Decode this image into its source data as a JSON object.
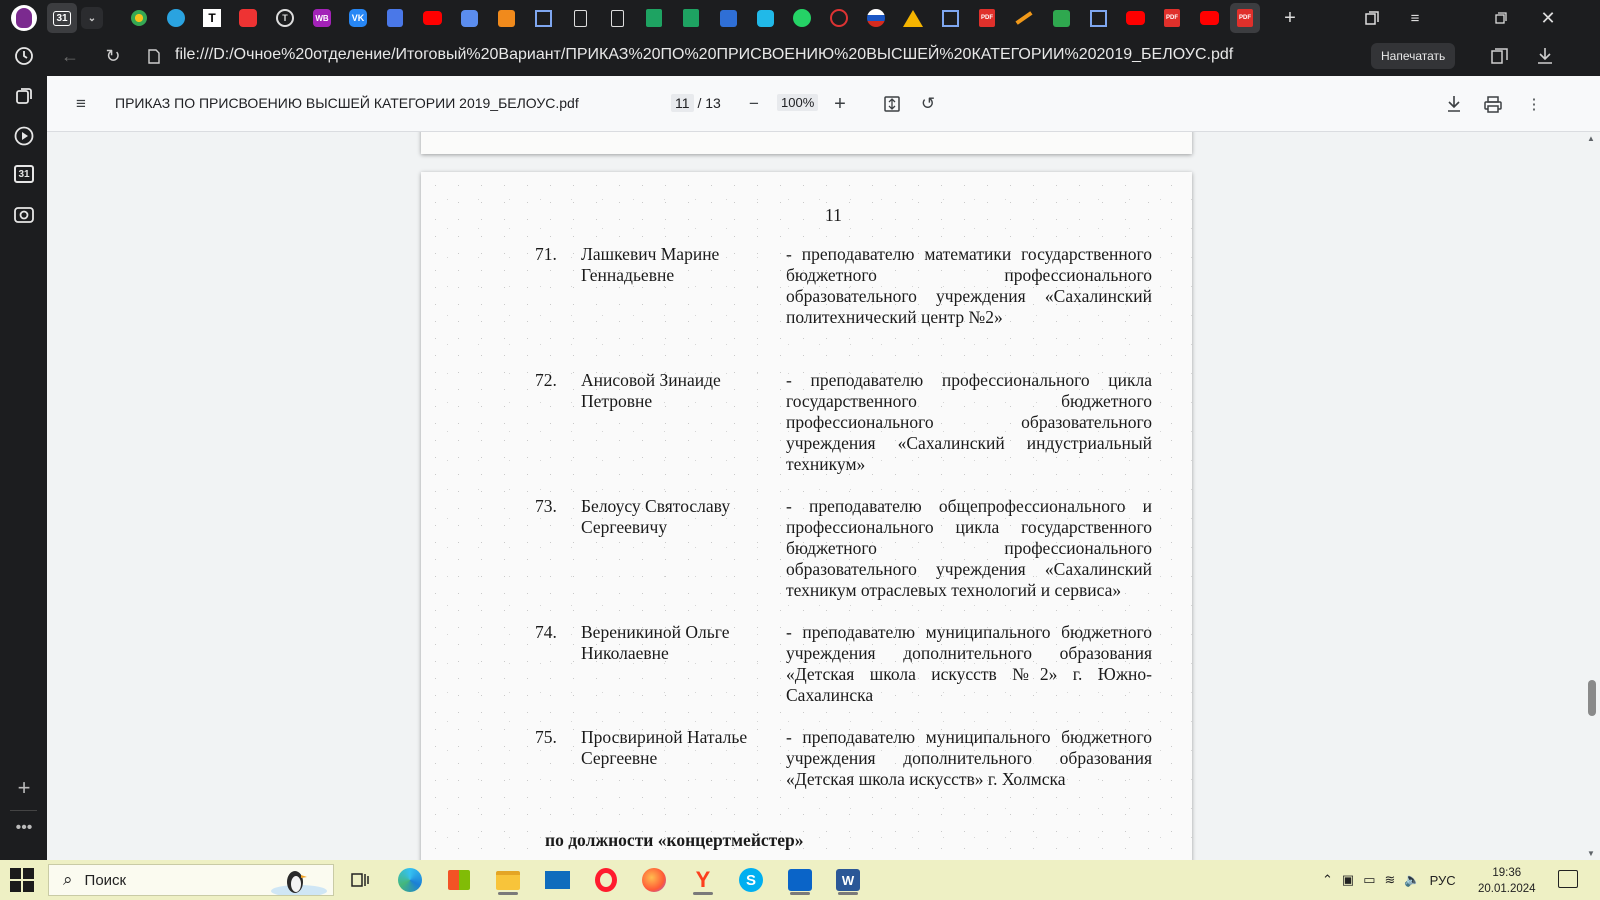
{
  "browser": {
    "url": "file:///D:/Очное%20отделение/Итоговый%20Вариант/ПРИКАЗ%20ПО%20ПРИСВОЕНИЮ%20ВЫСШЕЙ%20КАТЕГОРИИ%202019_БЕЛОУС.pdf",
    "print_button": "Напечатать",
    "active_tab_badge": "31",
    "sidebar_calendar": "31"
  },
  "pdf_toolbar": {
    "title": "ПРИКАЗ ПО ПРИСВОЕНИЮ ВЫСШЕЙ КАТЕГОРИИ 2019_БЕЛОУС.pdf",
    "current_page": "11",
    "page_separator": "/",
    "total_pages": "13",
    "zoom": "100%"
  },
  "document": {
    "page_number": "11",
    "entries": [
      {
        "num": "71.",
        "name": "Лашкевич Марине Геннадьевне",
        "desc": "- преподавателю математики государственного бюджетного профессионального образовательного учреждения «Сахалинский политехнический центр №2»"
      },
      {
        "num": "72.",
        "name": "Анисовой Зинаиде Петровне",
        "desc": "- преподавателю профессионального цикла государственного бюджетного профессионального образовательного учреждения «Сахалинский индустриальный техникум»"
      },
      {
        "num": "73.",
        "name": "Белоусу Святославу Сергеевичу",
        "desc": "- преподавателю общепрофессионального и профессионального цикла государственного бюджетного профессионального образовательного учреждения «Сахалинский техникум отраслевых технологий и сервиса»"
      },
      {
        "num": "74.",
        "name": "Вереникиной Ольге Николаевне",
        "desc": "- преподавателю муниципального бюджетного учреждения дополнительного образования «Детская школа искусств №2» г. Южно-Сахалинска"
      },
      {
        "num": "75.",
        "name": "Просвириной Наталье Сергеевне",
        "desc": "- преподавателю муниципального бюджетного учреждения дополнительного образования «Детская школа искусств» г. Холмска"
      }
    ],
    "section_heading": "по должности «концертмейстер»"
  },
  "taskbar": {
    "search_label": "Поиск",
    "language": "РУС",
    "time": "19:36",
    "date": "20.01.2024"
  },
  "colors": {
    "browser_chrome": "#1c1d1f",
    "pdf_toolbar": "#f8f9fa",
    "taskbar": "#eef0c4"
  }
}
